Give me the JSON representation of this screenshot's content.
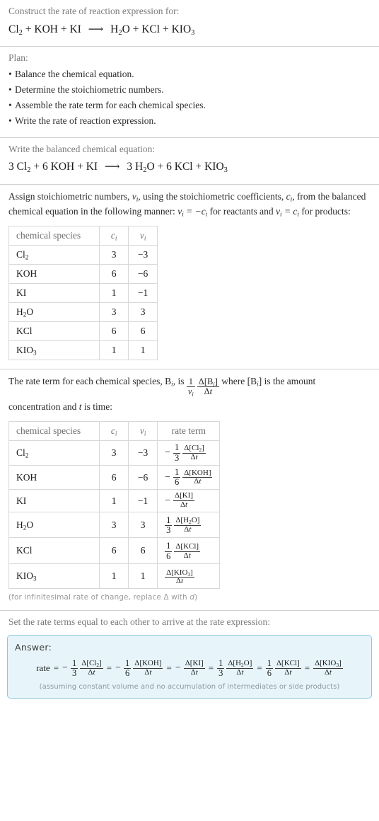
{
  "header": {
    "prompt": "Construct the rate of reaction expression for:",
    "reaction": {
      "reactants": [
        "Cl2",
        "KOH",
        "KI"
      ],
      "products": [
        "H2O",
        "KCl",
        "KIO3"
      ],
      "arrow": "⟶",
      "display": "Cl2 + KOH + KI ⟶ H2O + KCl + KIO3"
    }
  },
  "plan": {
    "title": "Plan:",
    "steps": [
      "Balance the chemical equation.",
      "Determine the stoichiometric numbers.",
      "Assemble the rate term for each chemical species.",
      "Write the rate of reaction expression."
    ]
  },
  "balanced": {
    "prompt": "Write the balanced chemical equation:",
    "reactant_coeffs": [
      "3",
      "6",
      ""
    ],
    "product_coeffs": [
      "3",
      "6",
      ""
    ],
    "display": "3 Cl2 + 6 KOH + KI ⟶ 3 H2O + 6 KCl + KIO3"
  },
  "stoich": {
    "text_line1_a": "Assign stoichiometric numbers, ",
    "text_line1_b": ", using the stoichiometric coefficients, ",
    "text_line1_c": ", from",
    "text_line2_a": "the balanced chemical equation in the following manner: ",
    "text_line2_b": " for reactants",
    "text_line3_a": "and ",
    "text_line3_b": " for products:",
    "sym_nu": "νi",
    "sym_c": "ci",
    "eq_reactants": "νi = −ci",
    "eq_products": "νi = ci"
  },
  "table1": {
    "headers": [
      "chemical species",
      "ci",
      "νi"
    ],
    "rows": [
      {
        "species": "Cl2",
        "c": "3",
        "v": "−3"
      },
      {
        "species": "KOH",
        "c": "6",
        "v": "−6"
      },
      {
        "species": "KI",
        "c": "1",
        "v": "−1"
      },
      {
        "species": "H2O",
        "c": "3",
        "v": "3"
      },
      {
        "species": "KCl",
        "c": "6",
        "v": "6"
      },
      {
        "species": "KIO3",
        "c": "1",
        "v": "1"
      }
    ]
  },
  "rateterm_intro": {
    "line1_a": "The rate term for each chemical species, ",
    "line1_b": ", is ",
    "line1_c": " where ",
    "line1_d": " is the amount",
    "line2": "concentration and t is time:",
    "sym_B": "Bi",
    "sym_Bbracket": "[Bi]",
    "frac_top": "1",
    "frac_bot": "νi",
    "delta_top": "Δ[Bi]",
    "delta_bot": "Δt"
  },
  "table2": {
    "headers": [
      "chemical species",
      "ci",
      "νi",
      "rate term"
    ],
    "rows": [
      {
        "species": "Cl2",
        "c": "3",
        "v": "−3",
        "sign": "−",
        "coef_num": "1",
        "coef_den": "3",
        "delta_top": "Δ[Cl2]",
        "delta_bot": "Δt"
      },
      {
        "species": "KOH",
        "c": "6",
        "v": "−6",
        "sign": "−",
        "coef_num": "1",
        "coef_den": "6",
        "delta_top": "Δ[KOH]",
        "delta_bot": "Δt"
      },
      {
        "species": "KI",
        "c": "1",
        "v": "−1",
        "sign": "−",
        "coef_num": "",
        "coef_den": "",
        "delta_top": "Δ[KI]",
        "delta_bot": "Δt"
      },
      {
        "species": "H2O",
        "c": "3",
        "v": "3",
        "sign": "",
        "coef_num": "1",
        "coef_den": "3",
        "delta_top": "Δ[H2O]",
        "delta_bot": "Δt"
      },
      {
        "species": "KCl",
        "c": "6",
        "v": "6",
        "sign": "",
        "coef_num": "1",
        "coef_den": "6",
        "delta_top": "Δ[KCl]",
        "delta_bot": "Δt"
      },
      {
        "species": "KIO3",
        "c": "1",
        "v": "1",
        "sign": "",
        "coef_num": "",
        "coef_den": "",
        "delta_top": "Δ[KIO3]",
        "delta_bot": "Δt"
      }
    ]
  },
  "infinitesimal_note": "(for infinitesimal rate of change, replace Δ with d)",
  "final": {
    "prompt": "Set the rate terms equal to each other to arrive at the rate expression:",
    "answer_label": "Answer:",
    "rate_word": "rate",
    "equals": "=",
    "terms": [
      {
        "sign": "−",
        "coef_num": "1",
        "coef_den": "3",
        "delta_top": "Δ[Cl2]",
        "delta_bot": "Δt"
      },
      {
        "sign": "−",
        "coef_num": "1",
        "coef_den": "6",
        "delta_top": "Δ[KOH]",
        "delta_bot": "Δt"
      },
      {
        "sign": "−",
        "coef_num": "",
        "coef_den": "",
        "delta_top": "Δ[KI]",
        "delta_bot": "Δt"
      },
      {
        "sign": "",
        "coef_num": "1",
        "coef_den": "3",
        "delta_top": "Δ[H2O]",
        "delta_bot": "Δt"
      },
      {
        "sign": "",
        "coef_num": "1",
        "coef_den": "6",
        "delta_top": "Δ[KCl]",
        "delta_bot": "Δt"
      },
      {
        "sign": "",
        "coef_num": "",
        "coef_den": "",
        "delta_top": "Δ[KIO3]",
        "delta_bot": "Δt"
      }
    ],
    "assumption": "(assuming constant volume and no accumulation of intermediates or side products)"
  },
  "colors": {
    "answer_bg": "#e7f5fa",
    "answer_border": "#8fc8dd",
    "muted_text": "#7a7a7a",
    "rule": "#cfcfcf",
    "table_border": "#d8d8d8"
  }
}
